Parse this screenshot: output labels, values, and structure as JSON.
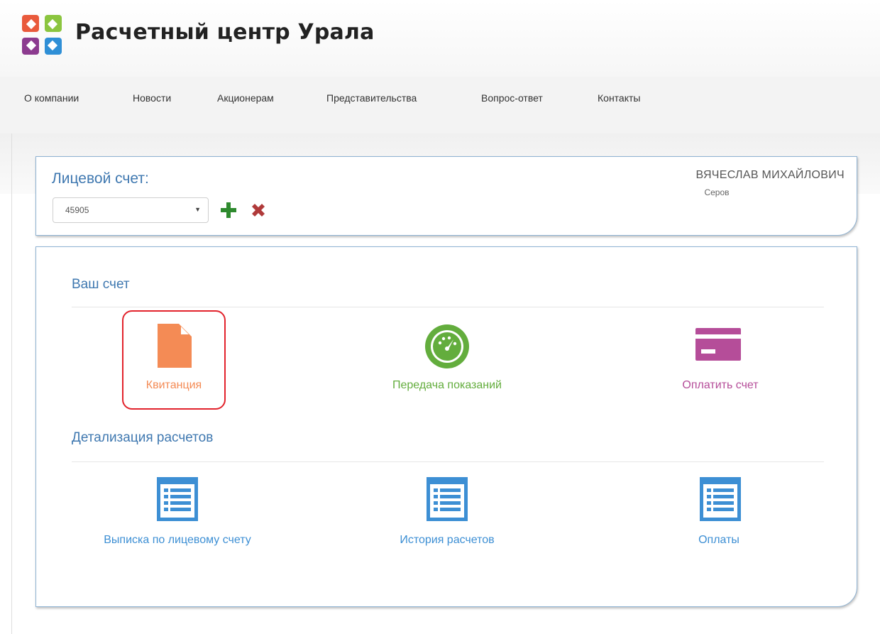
{
  "header": {
    "title": "Расчетный центр Урала",
    "logo_icon": "logo-icon"
  },
  "nav": {
    "items": [
      "О компании",
      "Новости",
      "Акционерам",
      "Представительства",
      "Вопрос-ответ",
      "Контакты"
    ]
  },
  "account": {
    "label": "Лицевой счет:",
    "selected_account": "45905",
    "add_icon": "plus-icon",
    "remove_icon": "close-icon",
    "user_name": "ВЯЧЕСЛАВ МИХАЙЛОВИЧ",
    "user_city": "Серов"
  },
  "sections": {
    "account_title": "Ваш счет",
    "details_title": "Детализация расчетов"
  },
  "tiles": {
    "receipt": {
      "label": "Квитанция",
      "icon": "document-icon",
      "color": "#f48b55"
    },
    "meter": {
      "label": "Передача показаний",
      "icon": "gauge-icon",
      "color": "#63ad3d"
    },
    "pay": {
      "label": "Оплатить счет",
      "icon": "credit-card-icon",
      "color": "#b54d99"
    },
    "statement": {
      "label": "Выписка по лицевому счету",
      "icon": "list-icon",
      "color": "#3d8fd4"
    },
    "history": {
      "label": "История расчетов",
      "icon": "list-icon",
      "color": "#3d8fd4"
    },
    "payments": {
      "label": "Оплаты",
      "icon": "list-icon",
      "color": "#3d8fd4"
    }
  },
  "colors": {
    "accent_blue": "#3f78b0",
    "highlight_red": "#e2232c",
    "add_green": "#2e8a2e",
    "remove_red": "#b03a3a"
  }
}
